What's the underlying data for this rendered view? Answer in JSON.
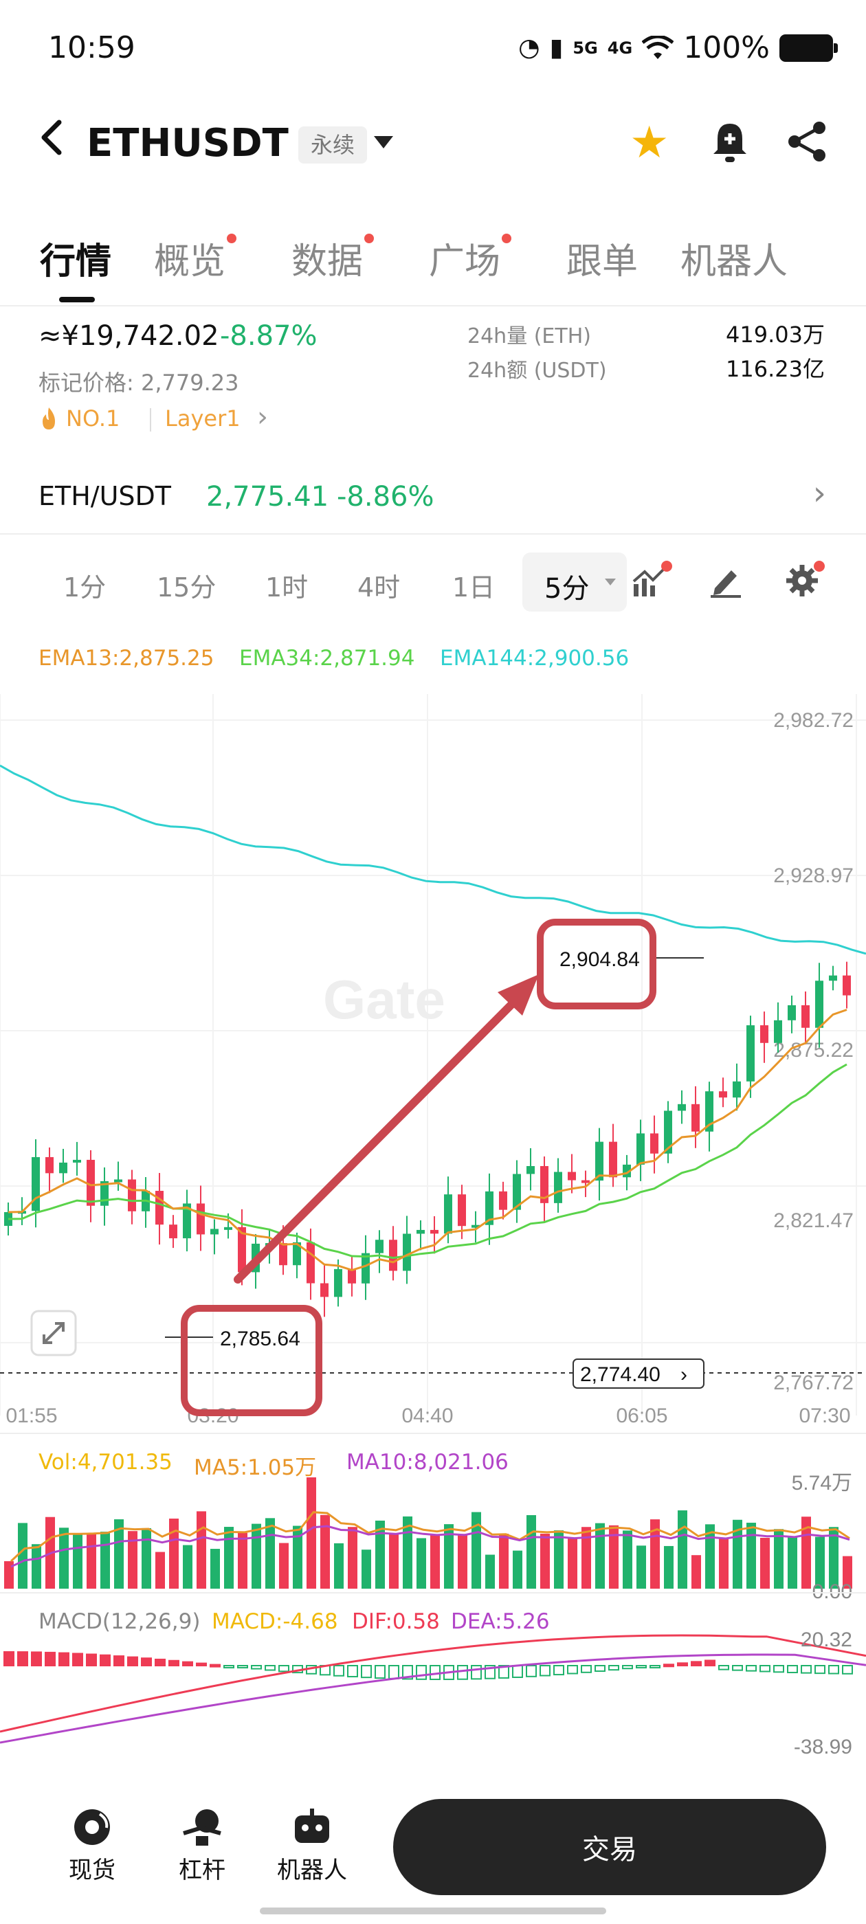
{
  "status_bar": {
    "time": "10:59",
    "battery": "100%",
    "net1": "5G",
    "net2": "4G"
  },
  "header": {
    "title": "ETHUSDT",
    "badge": "永续"
  },
  "tabs": [
    {
      "label": "行情",
      "active": true,
      "dot": false
    },
    {
      "label": "概览",
      "active": false,
      "dot": true
    },
    {
      "label": "数据",
      "active": false,
      "dot": true
    },
    {
      "label": "广场",
      "active": false,
      "dot": true
    },
    {
      "label": "跟单",
      "active": false,
      "dot": false
    },
    {
      "label": "机器人",
      "active": false,
      "dot": false
    }
  ],
  "info": {
    "cny_price": "≈¥19,742.02",
    "cny_change": "-8.87%",
    "mark_price": "标记价格: 2,779.23",
    "rank": "NO.1",
    "tag": "Layer1",
    "stats": [
      {
        "label": "24h量 (ETH)",
        "value": "419.03万"
      },
      {
        "label": "24h额 (USDT)",
        "value": "116.23亿"
      }
    ]
  },
  "spot": {
    "pair": "ETH/USDT",
    "price": "2,775.41",
    "change": "-8.86%"
  },
  "timeframes": [
    "1分",
    "15分",
    "1时",
    "4时",
    "1日"
  ],
  "active_timeframe": "5分",
  "ema": {
    "ema13": "EMA13:2,875.25",
    "ema34": "EMA34:2,871.94",
    "ema144": "EMA144:2,900.56"
  },
  "colors": {
    "up": "#20b26c",
    "down": "#ee3b54",
    "ema13": "#e8962a",
    "ema34": "#5ad34a",
    "ema144": "#2fd0cf",
    "annotation": "#c9474f",
    "ma10": "#b245c8",
    "macd_label": "#f0b90b"
  },
  "chart": {
    "price_axis": [
      "2,982.72",
      "2,928.97",
      "2,875.22",
      "2,821.47",
      "2,767.72"
    ],
    "time_axis": [
      "01:55",
      "03:20",
      "04:40",
      "06:05",
      "07:30"
    ],
    "low_marker": "2,785.64",
    "high_marker": "2,904.84",
    "current_price": "2,774.40",
    "watermark": "Gate"
  },
  "volume": {
    "vol": "Vol:4,701.35",
    "ma5": "MA5:1.05万",
    "ma10": "MA10:8,021.06",
    "max": "5.74万",
    "min": "0.00"
  },
  "macd": {
    "name": "MACD(12,26,9)",
    "macd": "MACD:-4.68",
    "dif": "DIF:0.58",
    "dea": "DEA:5.26",
    "max": "20.32",
    "min": "-38.99"
  },
  "nav": {
    "spot": "现货",
    "margin": "杠杆",
    "bot": "机器人",
    "trade": "交易"
  }
}
